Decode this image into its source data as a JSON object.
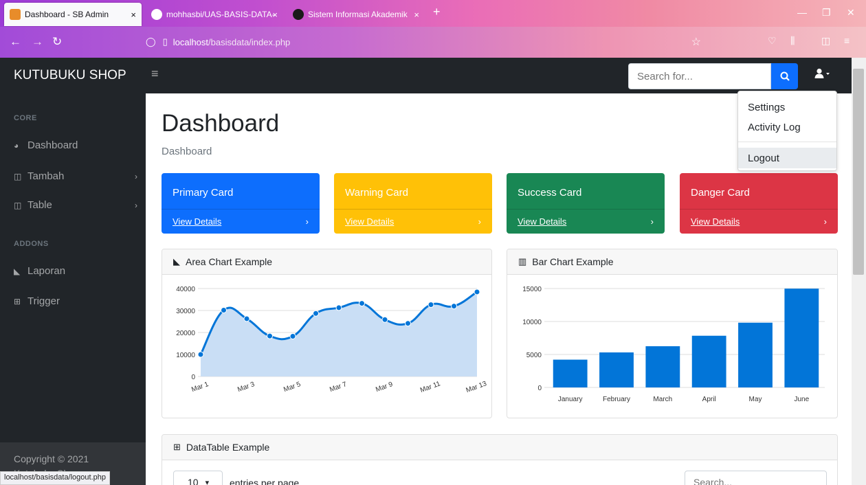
{
  "browser": {
    "tabs": [
      {
        "title": "Dashboard - SB Admin",
        "close": "×",
        "active": true
      },
      {
        "title": "mohhasbi/UAS-BASIS-DATA-",
        "close": "×",
        "active": false
      },
      {
        "title": "Sistem Informasi Akademik",
        "close": "×",
        "active": false
      }
    ],
    "new_tab": "+",
    "url_host": "localhost",
    "url_path": "/basisdata/index.php",
    "status_url": "localhost/basisdata/logout.php"
  },
  "navbar": {
    "brand": "KUTUBUKU SHOP",
    "search_placeholder": "Search for..."
  },
  "user_menu": {
    "items": [
      "Settings",
      "Activity Log",
      "Logout"
    ]
  },
  "sidebar": {
    "core_heading": "CORE",
    "addons_heading": "ADDONS",
    "items": [
      {
        "label": "Dashboard",
        "icon": "tachometer-icon"
      },
      {
        "label": "Tambah",
        "icon": "columns-icon"
      },
      {
        "label": "Table",
        "icon": "columns-icon"
      },
      {
        "label": "Laporan",
        "icon": "area-chart-icon"
      },
      {
        "label": "Trigger",
        "icon": "table-icon"
      }
    ],
    "footer_line1": "Copyright © 2021",
    "footer_line2": "Kutubuku Shop"
  },
  "main": {
    "title": "Dashboard",
    "breadcrumb": "Dashboard",
    "cards": [
      {
        "title": "Primary Card",
        "link": "View Details",
        "color": "#0d6efd"
      },
      {
        "title": "Warning Card",
        "link": "View Details",
        "color": "#ffc107"
      },
      {
        "title": "Success Card",
        "link": "View Details",
        "color": "#198754"
      },
      {
        "title": "Danger Card",
        "link": "View Details",
        "color": "#dc3545"
      }
    ],
    "area_chart_title": "Area Chart Example",
    "bar_chart_title": "Bar Chart Example",
    "datatable_title": "DataTable Example",
    "entries_value": "10",
    "entries_label": "entries per page",
    "table_search_placeholder": "Search..."
  },
  "chart_data": [
    {
      "type": "area",
      "x": [
        "Mar 1",
        "Mar 2",
        "Mar 3",
        "Mar 4",
        "Mar 5",
        "Mar 6",
        "Mar 7",
        "Mar 8",
        "Mar 9",
        "Mar 10",
        "Mar 11",
        "Mar 12",
        "Mar 13"
      ],
      "tick_labels": [
        "Mar 1",
        "Mar 3",
        "Mar 5",
        "Mar 7",
        "Mar 9",
        "Mar 11",
        "Mar 13"
      ],
      "values": [
        10000,
        30162,
        26263,
        18394,
        18287,
        28682,
        31274,
        33259,
        25849,
        24159,
        32651,
        31984,
        38451
      ],
      "ylim": [
        0,
        40000
      ],
      "yticks": [
        0,
        10000,
        20000,
        30000,
        40000
      ],
      "line_color": "#0275d8",
      "fill_color": "#c9def5"
    },
    {
      "type": "bar",
      "categories": [
        "January",
        "February",
        "March",
        "April",
        "May",
        "June"
      ],
      "values": [
        4215,
        5312,
        6251,
        7841,
        9821,
        14984
      ],
      "ylim": [
        0,
        15000
      ],
      "yticks": [
        0,
        5000,
        10000,
        15000
      ],
      "bar_color": "#0275d8"
    }
  ]
}
